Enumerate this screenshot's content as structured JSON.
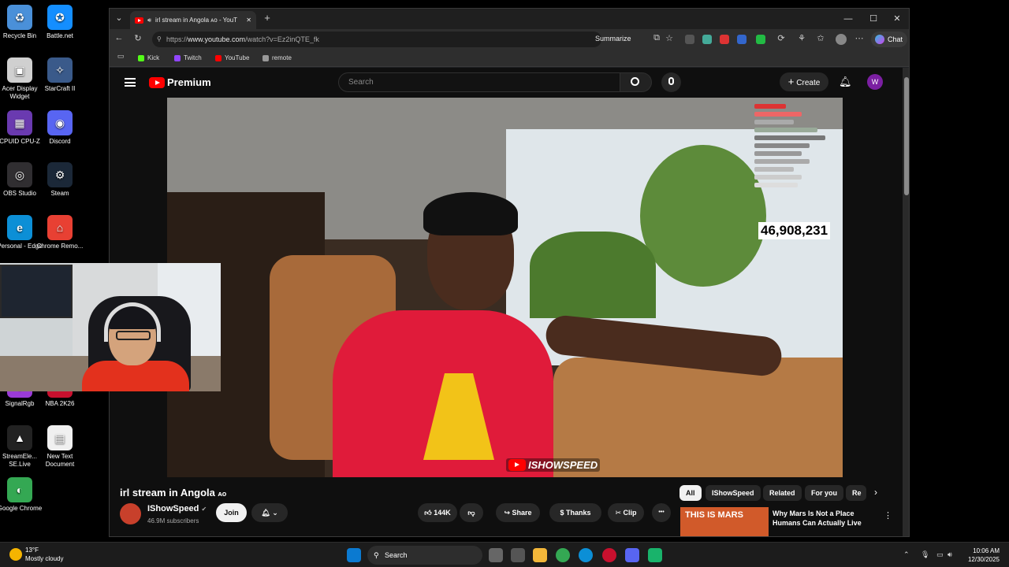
{
  "desktop": {
    "icons": [
      {
        "label": "Recycle Bin",
        "color": "#4a90d9",
        "glyph": "♻"
      },
      {
        "label": "Battle.net",
        "color": "#148eff",
        "glyph": "✪"
      },
      {
        "label": "Acer Display Widget",
        "color": "#d0d0d0",
        "glyph": "▣"
      },
      {
        "label": "StarCraft II",
        "color": "#3a5a8a",
        "glyph": "✧"
      },
      {
        "label": "CPUID CPU-Z",
        "color": "#6a3ab0",
        "glyph": "▦"
      },
      {
        "label": "Discord",
        "color": "#5865f2",
        "glyph": "◉"
      },
      {
        "label": "OBS Studio",
        "color": "#302e31",
        "glyph": "◎"
      },
      {
        "label": "Steam",
        "color": "#1b2838",
        "glyph": "⚙"
      },
      {
        "label": "Personal - Edge",
        "color": "#0c8fd6",
        "glyph": "e"
      },
      {
        "label": "Chrome Remo...",
        "color": "#e84033",
        "glyph": "⌂"
      },
      {
        "label": "SignalRgb",
        "color": "#9a3bd6",
        "glyph": "◇"
      },
      {
        "label": "NBA 2K26",
        "color": "#c8102e",
        "glyph": "N"
      },
      {
        "label": "StreamEle... SE.Live",
        "color": "#222",
        "glyph": "▲"
      },
      {
        "label": "New Text Document",
        "color": "#f0f0f0",
        "glyph": "▤"
      },
      {
        "label": "Google Chrome",
        "color": "#34a853",
        "glyph": "◐"
      }
    ]
  },
  "browser": {
    "tab_title": "irl stream in Angola ᴀᴏ - YouT",
    "tab_close": "✕",
    "new_tab": "+",
    "window_controls": {
      "minimize": "—",
      "maximize": "☐",
      "close": "✕"
    },
    "url_prefix": "https://",
    "url_host": "www.youtube.com",
    "url_path": "/watch?v=Ez2inQTE_fk",
    "summarize_label": "Summarize",
    "chat_label": "Chat",
    "bookmarks": [
      {
        "label": "Kick",
        "color": "#53fc18"
      },
      {
        "label": "Twitch",
        "color": "#9146ff"
      },
      {
        "label": "YouTube",
        "color": "#ff0000"
      },
      {
        "label": "remote",
        "color": "#999999"
      }
    ]
  },
  "youtube": {
    "logo_text": "Premium",
    "search_placeholder": "Search",
    "create_label": "Create",
    "avatar_letter": "W",
    "video": {
      "viewer_count": "46,908,231",
      "watermark": "ISHOWSPEED"
    },
    "title": "irl stream in Angola",
    "title_suffix": "ᴀᴏ",
    "channel_name": "IShowSpeed",
    "verified": "✔",
    "subscribers": "46.9M subscribers",
    "join_label": "Join",
    "likes": "144K",
    "share_label": "Share",
    "thanks_label": "Thanks",
    "clip_label": "Clip",
    "more_label": "•••",
    "chips": [
      "All",
      "IShowSpeed",
      "Related",
      "For you",
      "Re"
    ],
    "rec_thumb_text": "THIS IS MARS",
    "rec_title": "Why Mars Is Not a Place Humans Can Actually Live"
  },
  "taskbar": {
    "temperature": "13°F",
    "weather": "Mostly cloudy",
    "search_label": "Search",
    "time": "10:06 AM",
    "date": "12/30/2025"
  }
}
